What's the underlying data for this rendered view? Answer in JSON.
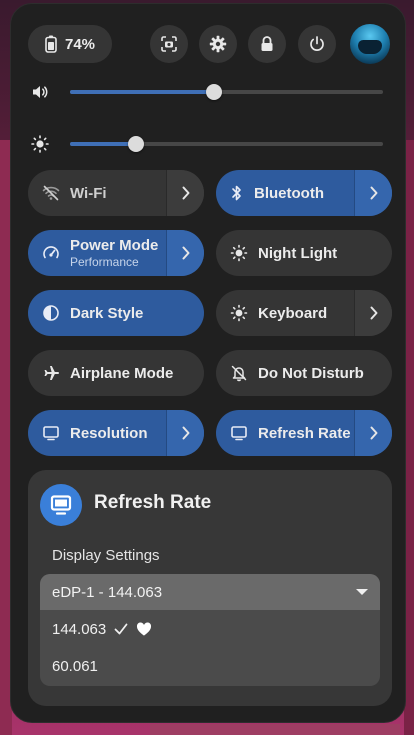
{
  "status": {
    "battery_level": "74%"
  },
  "top_buttons": [
    "screenshot-icon",
    "settings-icon",
    "lock-icon",
    "power-icon"
  ],
  "sliders": {
    "volume": {
      "icon": "speaker-icon",
      "level": 0.46
    },
    "brightness": {
      "icon": "sun-icon",
      "level": 0.21
    }
  },
  "toggles": {
    "wifi": {
      "label": "Wi-Fi",
      "active": false,
      "has_menu": true
    },
    "bluetooth": {
      "label": "Bluetooth",
      "active": true,
      "has_menu": true
    },
    "power_mode": {
      "label": "Power Mode",
      "subtitle": "Performance",
      "active": true,
      "has_menu": true
    },
    "night_light": {
      "label": "Night Light",
      "active": false,
      "has_menu": false
    },
    "dark_style": {
      "label": "Dark Style",
      "active": true,
      "has_menu": false
    },
    "keyboard": {
      "label": "Keyboard",
      "active": false,
      "has_menu": true
    },
    "airplane": {
      "label": "Airplane Mode",
      "active": false,
      "has_menu": false
    },
    "dnd": {
      "label": "Do Not Disturb",
      "active": false,
      "has_menu": false
    },
    "resolution": {
      "label": "Resolution",
      "active": true,
      "has_menu": true
    },
    "refresh_rate": {
      "label": "Refresh Rate",
      "active": true,
      "has_menu": true
    }
  },
  "menu": {
    "title": "Refresh Rate",
    "section": "Display Settings",
    "dropdown_selected": "eDP-1 - 144.063",
    "options": [
      {
        "label": "144.063",
        "current": true,
        "favorite": true
      },
      {
        "label": "60.061",
        "current": false,
        "favorite": false
      }
    ]
  },
  "colors": {
    "accent": "#3a7fd9",
    "tile_active": "#2e5b9e",
    "panel": "#202020"
  }
}
